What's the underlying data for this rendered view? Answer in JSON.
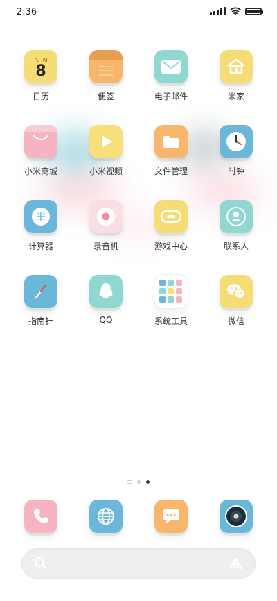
{
  "status": {
    "time": "2:36"
  },
  "apps": [
    {
      "name": "日历",
      "icon": "calendar-icon",
      "color": "#f6dc74",
      "day": "SUN",
      "date": "8"
    },
    {
      "name": "便签",
      "icon": "notes-icon",
      "color": "#f7b66c"
    },
    {
      "name": "电子邮件",
      "icon": "mail-icon",
      "color": "#90d7d2"
    },
    {
      "name": "米家",
      "icon": "home-icon",
      "color": "#f6dc74"
    },
    {
      "name": "小米商城",
      "icon": "shopping-bag-icon",
      "color": "#f6b4c2"
    },
    {
      "name": "小米视频",
      "icon": "play-icon",
      "color": "#f7e07a"
    },
    {
      "name": "文件管理",
      "icon": "folder-icon",
      "color": "#f7b66c"
    },
    {
      "name": "时钟",
      "icon": "clock-icon",
      "color": "#6bb7d9"
    },
    {
      "name": "计算器",
      "icon": "calculator-icon",
      "color": "#6bb7d9"
    },
    {
      "name": "录音机",
      "icon": "record-icon",
      "color": "#f9dfe3"
    },
    {
      "name": "游戏中心",
      "icon": "gamepad-icon",
      "color": "#f6dc74"
    },
    {
      "name": "联系人",
      "icon": "contact-icon",
      "color": "#90d7d2"
    },
    {
      "name": "指南针",
      "icon": "compass-icon",
      "color": "#6bb7d9"
    },
    {
      "name": "QQ",
      "icon": "penguin-icon",
      "color": "#90d7d2"
    },
    {
      "name": "系统工具",
      "icon": "folder-grid-icon",
      "color": "#ffffff"
    },
    {
      "name": "微信",
      "icon": "wechat-icon",
      "color": "#f6dc74"
    }
  ],
  "page_indicator": {
    "count": 3,
    "active": 3
  },
  "dock": [
    {
      "icon": "phone-icon",
      "color": "#f6b4c2"
    },
    {
      "icon": "browser-globe-icon",
      "color": "#6bb7d9"
    },
    {
      "icon": "messages-icon",
      "color": "#f7b66c"
    },
    {
      "icon": "camera-icon",
      "color": "#6bb7d9"
    }
  ]
}
